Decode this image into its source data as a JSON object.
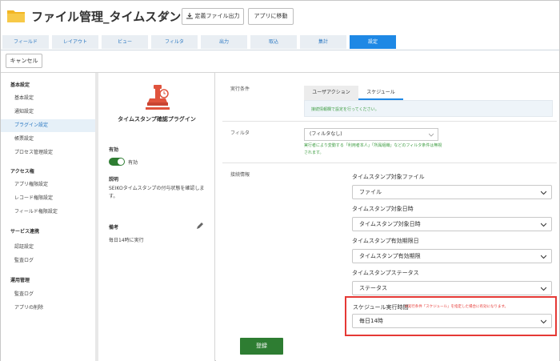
{
  "header": {
    "title": "ファイル管理_タイムスタンプ",
    "export_label": "定義ファイル出力",
    "to_app_label": "アプリに移動"
  },
  "tabs": [
    "フィールド",
    "レイアウト",
    "ビュー",
    "フィルタ",
    "出力",
    "取込",
    "集計",
    "設定"
  ],
  "active_tab": "設定",
  "cancel_label": "キャンセル",
  "sidebar": {
    "sections": [
      {
        "title": "基本設定",
        "items": [
          "基本設定",
          "通知設定",
          "プラグイン設定",
          "帳票設定",
          "プロセス管理設定"
        ]
      },
      {
        "title": "アクセス権",
        "items": [
          "アプリ権限設定",
          "レコード権限設定",
          "フィールド権限設定"
        ]
      },
      {
        "title": "サービス連携",
        "items": [
          "認証設定",
          "監査ログ"
        ]
      },
      {
        "title": "運用管理",
        "items": [
          "監査ログ",
          "アプリの削除"
        ]
      }
    ],
    "active_item": "プラグイン設定"
  },
  "plugin": {
    "name": "タイムスタンプ確認プラグイン",
    "enabled_title": "有効",
    "enabled_value": "有効",
    "desc_title": "説明",
    "desc_text": "SEIKOタイムスタンプの付与状態を確認します。",
    "memo_title": "備考",
    "memo_text": "毎日14時に実行"
  },
  "settings": {
    "exec_label": "実行条件",
    "subtabs": [
      "ユーザアクション",
      "スケジュール"
    ],
    "active_subtab": "スケジュール",
    "info_text": "接続情報欄で設定を行ってください。",
    "filter_label": "フィルタ",
    "filter_value": "(フィルタなし)",
    "filter_note": "実行者により変動する「利用者本人」「所属組織」などのフィルタ条件は無視されます。",
    "conn_label": "接続情報",
    "fields": [
      {
        "label": "タイムスタンプ対象ファイル",
        "value": "ファイル"
      },
      {
        "label": "タイムスタンプ対象日時",
        "value": "タイムスタンプ対象日時"
      },
      {
        "label": "タイムスタンプ有効期限日",
        "value": "タイムスタンプ有効期限"
      },
      {
        "label": "タイムスタンプステータス",
        "value": "ステータス"
      }
    ],
    "schedule_label": "スケジュール実行時間",
    "schedule_note": "※実行条件「スケジュール」を指定した場合に有効になります。",
    "schedule_value": "毎日14時",
    "register_label": "登録"
  },
  "colors": {
    "accent": "#1e88e5",
    "green": "#2e7d32",
    "highlight": "#e53935"
  }
}
